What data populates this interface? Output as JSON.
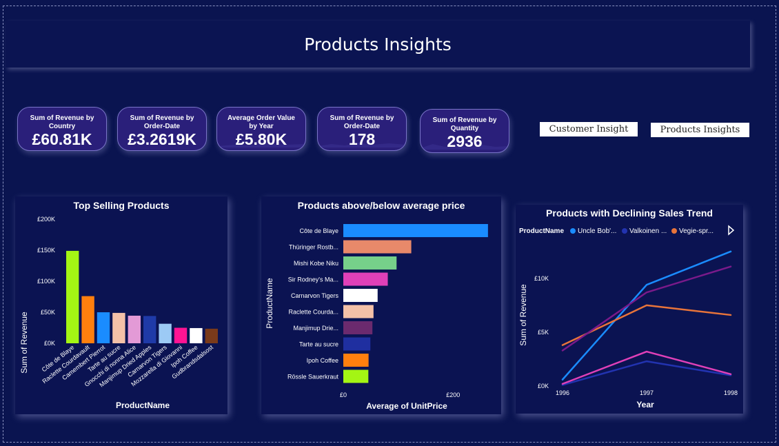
{
  "page": {
    "title": "Products Insights"
  },
  "kpis": [
    {
      "label": "Sum of Revenue by Country",
      "value": "£60.81K"
    },
    {
      "label": "Sum of Revenue by Order-Date",
      "value": "£3.2619K"
    },
    {
      "label": "Average Order Value by Year",
      "value": "£5.80K"
    },
    {
      "label": "Sum of Revenue by Order-Date",
      "value": "178"
    },
    {
      "label": "Sum of Revenue by Quantity",
      "value": "2936"
    }
  ],
  "nav": {
    "customer_insight": "Customer Insight",
    "products_insights": "Products Insights"
  },
  "colors": {
    "background": "#0a1450",
    "panel": "#0b1352",
    "kpi": "#2a1f7a"
  },
  "charts": {
    "top_selling": {
      "title": "Top Selling Products",
      "xlabel": "ProductName",
      "ylabel": "Sum of Revenue",
      "yticks": [
        "£0K",
        "£50K",
        "£100K",
        "£150K",
        "£200K"
      ]
    },
    "avg_price": {
      "title": "Products above/below average price",
      "xlabel": "Average of UnitPrice",
      "ylabel": "ProductName",
      "xticks": [
        "£0",
        "£200"
      ]
    },
    "declining": {
      "title": "Products with Declining Sales Trend",
      "xlabel": "Year",
      "ylabel": "Sum of Revenue",
      "legend_title": "ProductName",
      "legend_items": [
        "Uncle Bob'...",
        "Valkoinen ...",
        "Vegie-spr..."
      ],
      "yticks": [
        "£0K",
        "£5K",
        "£10K"
      ],
      "xticks": [
        "1996",
        "1997",
        "1998"
      ]
    }
  },
  "chart_data": [
    {
      "type": "bar",
      "title": "Top Selling Products",
      "xlabel": "ProductName",
      "ylabel": "Sum of Revenue",
      "ylim": [
        0,
        200000
      ],
      "categories": [
        "Côte de Blaye",
        "Raclette Courdavault",
        "Camembert Pierrot",
        "Tarte au sucre",
        "Gnocchi di nonna Alice",
        "Manjimup Dried Apples",
        "Carnarvon Tigers",
        "Mozzarella di Giovanni",
        "Ipoh Coffee",
        "Gudbrandsdalsost"
      ],
      "values": [
        149000,
        76000,
        50000,
        49000,
        44500,
        44000,
        31500,
        25000,
        24500,
        23500
      ],
      "colors": [
        "#a4f514",
        "#ff7f0e",
        "#1a8cff",
        "#f4c1a8",
        "#e39ad6",
        "#1f3aa8",
        "#9ccaf5",
        "#ff1493",
        "#ffffff",
        "#7a3a1a"
      ]
    },
    {
      "type": "bar",
      "orientation": "horizontal",
      "title": "Products above/below average price",
      "xlabel": "Average of UnitPrice",
      "ylabel": "ProductName",
      "xlim": [
        0,
        280
      ],
      "categories": [
        "Côte de Blaye",
        "Thüringer Rostb...",
        "Mishi Kobe Niku",
        "Sir Rodney's Ma...",
        "Carnarvon Tigers",
        "Raclette Courda...",
        "Manjimup Drie...",
        "Tarte au sucre",
        "Ipoh Coffee",
        "Rössle Sauerkraut"
      ],
      "values": [
        263.5,
        123.79,
        97,
        81,
        62.5,
        55,
        53,
        49.3,
        46,
        45.6
      ],
      "colors": [
        "#1a8cff",
        "#e8896a",
        "#76d08a",
        "#e040b8",
        "#ffffff",
        "#f4c1a8",
        "#6b2a6e",
        "#1f2fa0",
        "#ff7f0e",
        "#a4f514"
      ]
    },
    {
      "type": "line",
      "title": "Products with Declining Sales Trend",
      "xlabel": "Year",
      "ylabel": "Sum of Revenue",
      "x": [
        "1996",
        "1997",
        "1998"
      ],
      "ylim": [
        0,
        13000
      ],
      "legend": "top",
      "series": [
        {
          "name": "Uncle Bob'...",
          "values": [
            600,
            9400,
            12500
          ],
          "color": "#1a8cff"
        },
        {
          "name": "Valkoinen ...",
          "values": [
            100,
            2300,
            1000
          ],
          "color": "#2233b0"
        },
        {
          "name": "Vegie-spr...",
          "values": [
            3800,
            7500,
            6600
          ],
          "color": "#e8743a"
        },
        {
          "values": [
            3300,
            8700,
            11100
          ],
          "color": "#7a1a8a"
        },
        {
          "values": [
            200,
            3200,
            1100
          ],
          "color": "#e040b8"
        }
      ]
    }
  ]
}
